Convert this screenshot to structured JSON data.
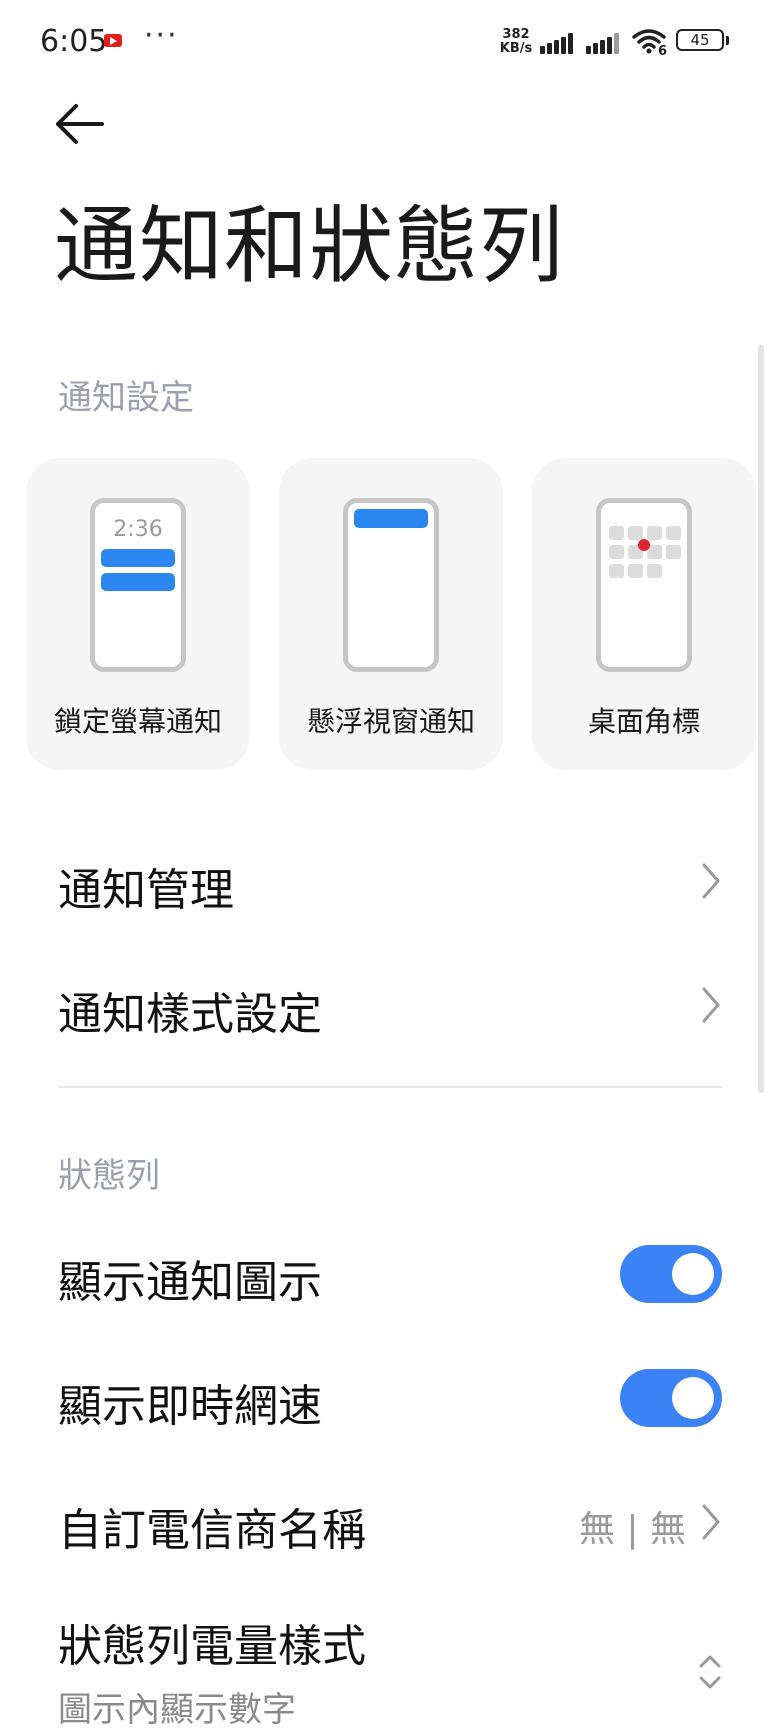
{
  "status_bar": {
    "time": "6:05",
    "dots": "···",
    "net_speed_value": "382",
    "net_speed_unit": "KB/s",
    "wifi_gen": "6",
    "battery": "45",
    "icons": [
      "youtube-icon",
      "signal-icon",
      "signal-icon",
      "wifi-icon",
      "battery-icon"
    ]
  },
  "header": {
    "back_icon": "arrow-left-icon",
    "title": "通知和狀態列"
  },
  "notification_section": {
    "header": "通知設定",
    "cards": [
      {
        "label": "鎖定螢幕通知",
        "mock_time": "2:36"
      },
      {
        "label": "懸浮視窗通知"
      },
      {
        "label": "桌面角標"
      }
    ],
    "items": [
      {
        "label": "通知管理"
      },
      {
        "label": "通知樣式設定"
      }
    ]
  },
  "status_bar_section": {
    "header": "狀態列",
    "toggles": [
      {
        "label": "顯示通知圖示",
        "on": true
      },
      {
        "label": "顯示即時網速",
        "on": true
      }
    ],
    "carrier": {
      "label": "自訂電信商名稱",
      "value": "無 | 無"
    },
    "battery_style": {
      "label": "狀態列電量樣式",
      "value": "圖示內顯示數字"
    }
  },
  "colors": {
    "accent": "#3b82f6",
    "banner": "#2b86f0",
    "badge": "#e0232c",
    "section_header": "#9aa0b0"
  }
}
